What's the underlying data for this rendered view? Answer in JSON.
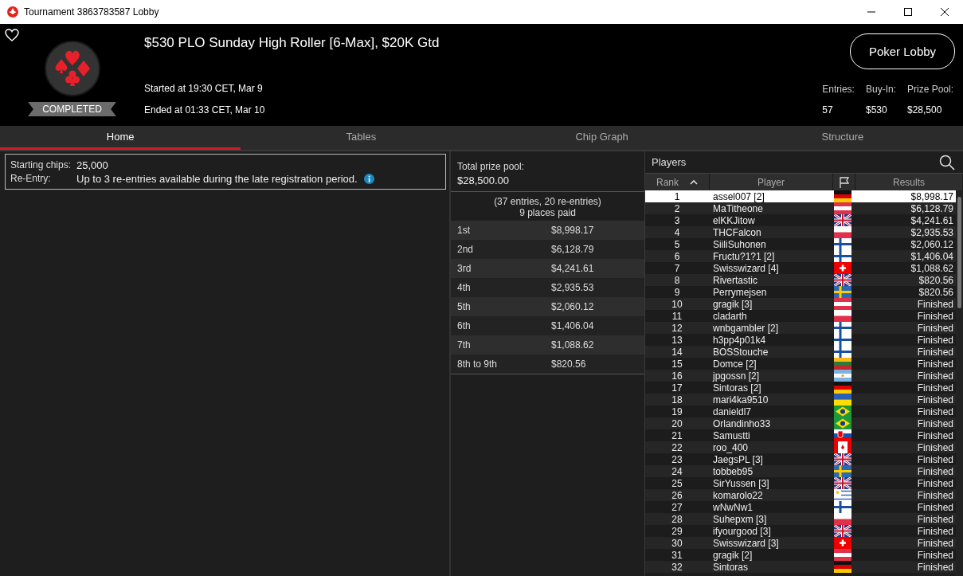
{
  "window": {
    "title": "Tournament 3863783587 Lobby"
  },
  "header": {
    "favorite": false,
    "status": "COMPLETED",
    "tournament_name": "$530 PLO Sunday High Roller [6-Max], $20K Gtd",
    "started": "Started at 19:30 CET, Mar 9",
    "ended": "Ended at 01:33 CET, Mar 10",
    "poker_lobby_button": "Poker Lobby",
    "stats": [
      {
        "label": "Entries:",
        "value": "57"
      },
      {
        "label": "Buy-In:",
        "value": "$530"
      },
      {
        "label": "Prize Pool:",
        "value": "$28,500"
      }
    ]
  },
  "tabs": [
    {
      "label": "Home",
      "selected": true
    },
    {
      "label": "Tables",
      "selected": false
    },
    {
      "label": "Chip Graph",
      "selected": false
    },
    {
      "label": "Structure",
      "selected": false
    }
  ],
  "home": {
    "info": [
      {
        "label": "Starting chips:",
        "value": "25,000",
        "info_icon": false
      },
      {
        "label": "Re-Entry:",
        "value": "Up to 3 re-entries available during the late registration period.",
        "info_icon": true
      }
    ]
  },
  "prizes": {
    "label": "Total prize pool:",
    "total": "$28,500.00",
    "entries_note": "(37 entries, 20 re-entries)",
    "places_note": "9 places paid",
    "rows": [
      {
        "place": "1st",
        "amount": "$8,998.17"
      },
      {
        "place": "2nd",
        "amount": "$6,128.79"
      },
      {
        "place": "3rd",
        "amount": "$4,241.61"
      },
      {
        "place": "4th",
        "amount": "$2,935.53"
      },
      {
        "place": "5th",
        "amount": "$2,060.12"
      },
      {
        "place": "6th",
        "amount": "$1,406.04"
      },
      {
        "place": "7th",
        "amount": "$1,088.62"
      },
      {
        "place": "8th to 9th",
        "amount": "$820.56"
      }
    ]
  },
  "players": {
    "title": "Players",
    "columns": [
      "Rank",
      "Player",
      "Results"
    ],
    "rows": [
      {
        "rank": "1",
        "player": "assel007 [2]",
        "kind": "de",
        "result": "$8,998.17",
        "selected": true
      },
      {
        "rank": "2",
        "player": "MaTitheone",
        "kind": "at",
        "result": "$6,128.79",
        "selected": false
      },
      {
        "rank": "3",
        "player": "elKKJitow",
        "kind": "gb",
        "result": "$4,241.61",
        "selected": false
      },
      {
        "rank": "4",
        "player": "THCFalcon",
        "kind": "pl",
        "result": "$2,935.53",
        "selected": false
      },
      {
        "rank": "5",
        "player": "SiiliSuhonen",
        "kind": "fi",
        "result": "$2,060.12",
        "selected": false
      },
      {
        "rank": "6",
        "player": "Fructu?1?1 [2]",
        "kind": "fi",
        "result": "$1,406.04",
        "selected": false
      },
      {
        "rank": "7",
        "player": "Swisswizard [4]",
        "kind": "ch",
        "result": "$1,088.62",
        "selected": false
      },
      {
        "rank": "8",
        "player": "Rivertastic",
        "kind": "gb",
        "result": "$820.56",
        "selected": false
      },
      {
        "rank": "9",
        "player": "Perrymejsen",
        "kind": "se",
        "result": "$820.56",
        "selected": false
      },
      {
        "rank": "10",
        "player": "gragik [3]",
        "kind": "at",
        "result": "Finished",
        "selected": false
      },
      {
        "rank": "11",
        "player": "cladarth",
        "kind": "pl",
        "result": "Finished",
        "selected": false
      },
      {
        "rank": "12",
        "player": "wnbgambler [2]",
        "kind": "fi",
        "result": "Finished",
        "selected": false
      },
      {
        "rank": "13",
        "player": "h3pp4p01k4",
        "kind": "fi",
        "result": "Finished",
        "selected": false
      },
      {
        "rank": "14",
        "player": "BOSStouche",
        "kind": "fi",
        "result": "Finished",
        "selected": false
      },
      {
        "rank": "15",
        "player": "Domce [2]",
        "kind": "lt",
        "result": "Finished",
        "selected": false
      },
      {
        "rank": "16",
        "player": "jpgossn [2]",
        "kind": "ar",
        "result": "Finished",
        "selected": false
      },
      {
        "rank": "17",
        "player": "Sintoras [2]",
        "kind": "de",
        "result": "Finished",
        "selected": false
      },
      {
        "rank": "18",
        "player": "mari4ka9510",
        "kind": "ua",
        "result": "Finished",
        "selected": false
      },
      {
        "rank": "19",
        "player": "danieldl7",
        "kind": "br",
        "result": "Finished",
        "selected": false
      },
      {
        "rank": "20",
        "player": "Orlandinho33",
        "kind": "br",
        "result": "Finished",
        "selected": false
      },
      {
        "rank": "21",
        "player": "Samustti",
        "kind": "sk",
        "result": "Finished",
        "selected": false
      },
      {
        "rank": "22",
        "player": "roo_400",
        "kind": "ca",
        "result": "Finished",
        "selected": false
      },
      {
        "rank": "23",
        "player": "JaegsPL [3]",
        "kind": "gb",
        "result": "Finished",
        "selected": false
      },
      {
        "rank": "24",
        "player": "tobbeb95",
        "kind": "se",
        "result": "Finished",
        "selected": false
      },
      {
        "rank": "25",
        "player": "SirYussen [3]",
        "kind": "gb",
        "result": "Finished",
        "selected": false
      },
      {
        "rank": "26",
        "player": "komarolo22",
        "kind": "uy",
        "result": "Finished",
        "selected": false
      },
      {
        "rank": "27",
        "player": "wNwNw1",
        "kind": "fi",
        "result": "Finished",
        "selected": false
      },
      {
        "rank": "28",
        "player": "Suhepxm [3]",
        "kind": "pl",
        "result": "Finished",
        "selected": false
      },
      {
        "rank": "29",
        "player": "ifyourgood [3]",
        "kind": "gb",
        "result": "Finished",
        "selected": false
      },
      {
        "rank": "30",
        "player": "Swisswizard [3]",
        "kind": "ch",
        "result": "Finished",
        "selected": false
      },
      {
        "rank": "31",
        "player": "gragik [2]",
        "kind": "at",
        "result": "Finished",
        "selected": false
      },
      {
        "rank": "32",
        "player": "Sintoras",
        "kind": "de",
        "result": "Finished",
        "selected": false
      }
    ]
  }
}
